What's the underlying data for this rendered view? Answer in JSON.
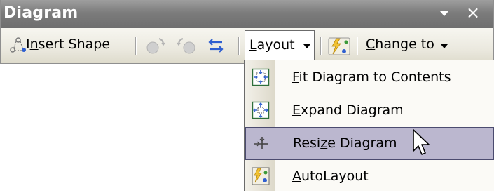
{
  "toolbar": {
    "title": "Diagram",
    "insert_shape": {
      "pre": "I",
      "underline": "n",
      "post": "sert Shape"
    },
    "layout": {
      "underline": "L",
      "post": "ayout"
    },
    "change_to": {
      "underline": "C",
      "post": "hange to"
    }
  },
  "menu": {
    "items": [
      {
        "underline": "F",
        "post": "it Diagram to Contents",
        "pre": "",
        "icon": "fit-diagram-icon"
      },
      {
        "underline": "E",
        "post": "xpand Diagram",
        "pre": "",
        "icon": "expand-diagram-icon"
      },
      {
        "pre": "Resi",
        "underline": "z",
        "post": "e Diagram",
        "icon": "resize-diagram-icon",
        "highlighted": true
      },
      {
        "underline": "A",
        "post": "utoLayout",
        "pre": "",
        "icon": "autolayout-icon"
      }
    ]
  },
  "colors": {
    "title_bar": "#7c7c7c",
    "toolbar_strip": "#ebe9df",
    "menu_highlight": "#bbb7cf",
    "icon_blue": "#2f5fd0",
    "icon_green": "#3a9a3a"
  }
}
